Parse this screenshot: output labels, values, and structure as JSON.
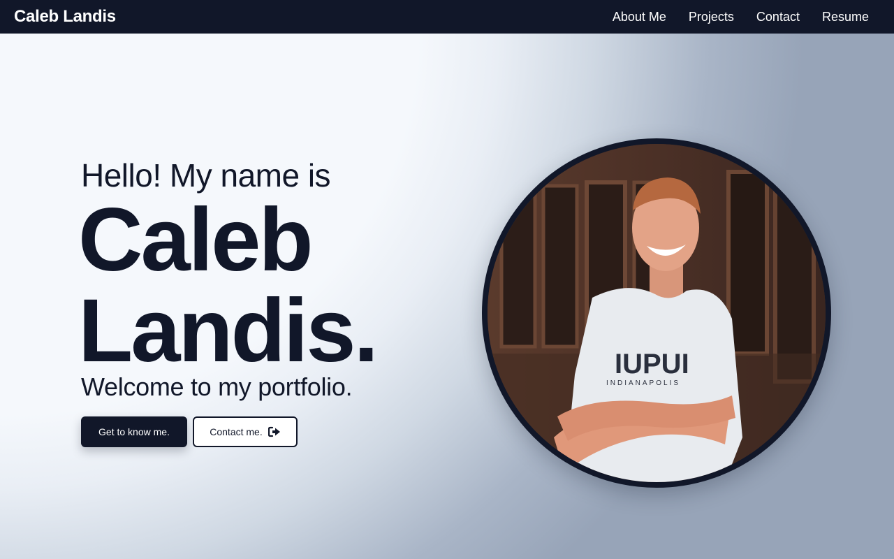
{
  "nav": {
    "brand": "Caleb Landis",
    "links": [
      "About Me",
      "Projects",
      "Contact",
      "Resume"
    ]
  },
  "hero": {
    "greeting": "Hello! My name is",
    "name_first": "Caleb",
    "name_last": "Landis.",
    "welcome": "Welcome to my portfolio.",
    "primary_button": "Get to know me.",
    "secondary_button": "Contact me.",
    "secondary_button_icon": "sign-out-icon",
    "portrait_shirt_text": "IUPUI",
    "portrait_shirt_subtext": "INDIANAPOLIS"
  },
  "colors": {
    "navy": "#111729",
    "background": "#f5f8fc",
    "gradient_corner": "#97a4b8",
    "white": "#ffffff"
  }
}
